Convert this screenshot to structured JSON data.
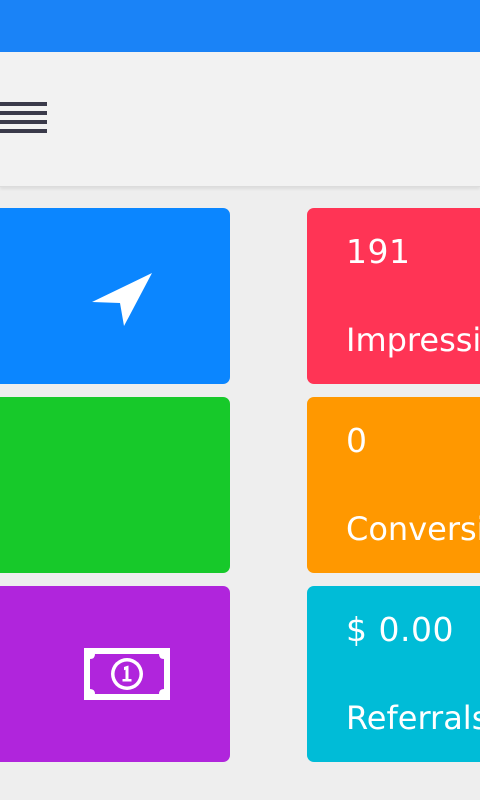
{
  "colors": {
    "status_bar": "#1a83f7",
    "toolbar": "#f2f2f2",
    "background": "#eeeeee",
    "tile_blue": "#0b86ff",
    "tile_green": "#17c92a",
    "tile_purple": "#b025dc",
    "tile_red": "#ff3455",
    "tile_orange": "#ff9800",
    "tile_cyan": "#00bcd7"
  },
  "toolbar": {
    "menu_icon": "hamburger-menu-icon"
  },
  "left_tiles": [
    {
      "icon": "navigation-arrow-icon",
      "color": "#0b86ff"
    },
    {
      "icon": "",
      "color": "#17c92a"
    },
    {
      "icon": "money-bill-icon",
      "color": "#b025dc"
    }
  ],
  "stats": [
    {
      "value": "191",
      "label": "Impressions",
      "color": "#ff3455"
    },
    {
      "value": "0",
      "label": "Conversions",
      "color": "#ff9800"
    },
    {
      "value": "$ 0.00",
      "label": "Referrals",
      "color": "#00bcd7"
    }
  ]
}
